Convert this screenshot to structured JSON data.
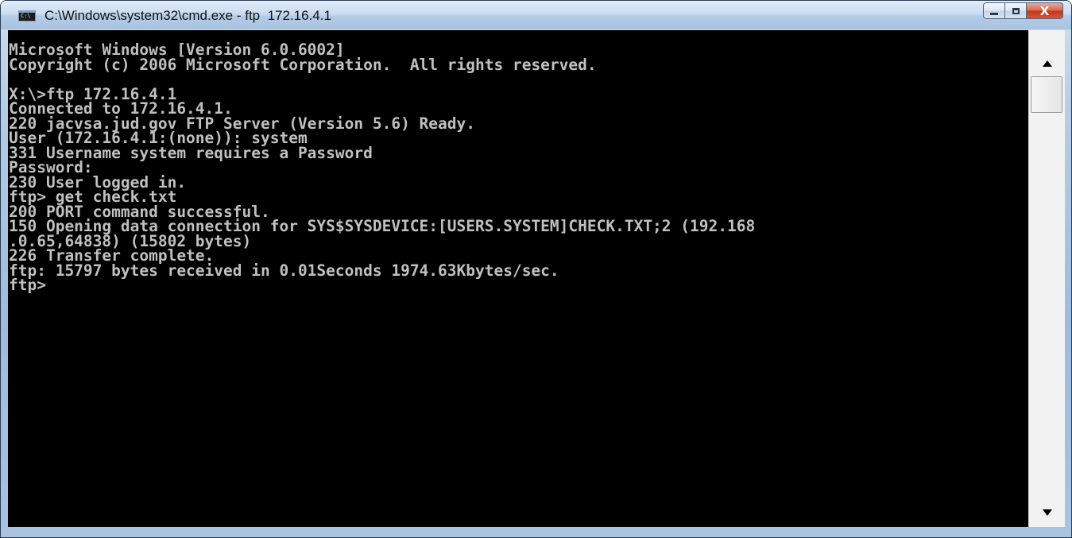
{
  "window": {
    "title": "C:\\Windows\\system32\\cmd.exe - ftp  172.16.4.1",
    "icon": "cmd-icon",
    "icon_text": "C:\\",
    "controls": {
      "minimize": "minimize-icon",
      "maximize": "maximize-icon",
      "close_label": "X"
    }
  },
  "console": {
    "lines": [
      "Microsoft Windows [Version 6.0.6002]",
      "Copyright (c) 2006 Microsoft Corporation.  All rights reserved.",
      "",
      "X:\\>ftp 172.16.4.1",
      "Connected to 172.16.4.1.",
      "220 jacvsa.jud.gov FTP Server (Version 5.6) Ready.",
      "User (172.16.4.1:(none)): system",
      "331 Username system requires a Password",
      "Password:",
      "230 User logged in.",
      "ftp> get check.txt",
      "200 PORT command successful.",
      "150 Opening data connection for SYS$SYSDEVICE:[USERS.SYSTEM]CHECK.TXT;2 (192.168",
      ".0.65,64838) (15802 bytes)",
      "226 Transfer complete.",
      "ftp: 15797 bytes received in 0.01Seconds 1974.63Kbytes/sec.",
      "ftp>"
    ],
    "text_color": "#c0c0c0",
    "background_color": "#000000"
  },
  "scrollbar": {
    "up_icon": "arrow-up-icon",
    "down_icon": "arrow-down-icon"
  }
}
